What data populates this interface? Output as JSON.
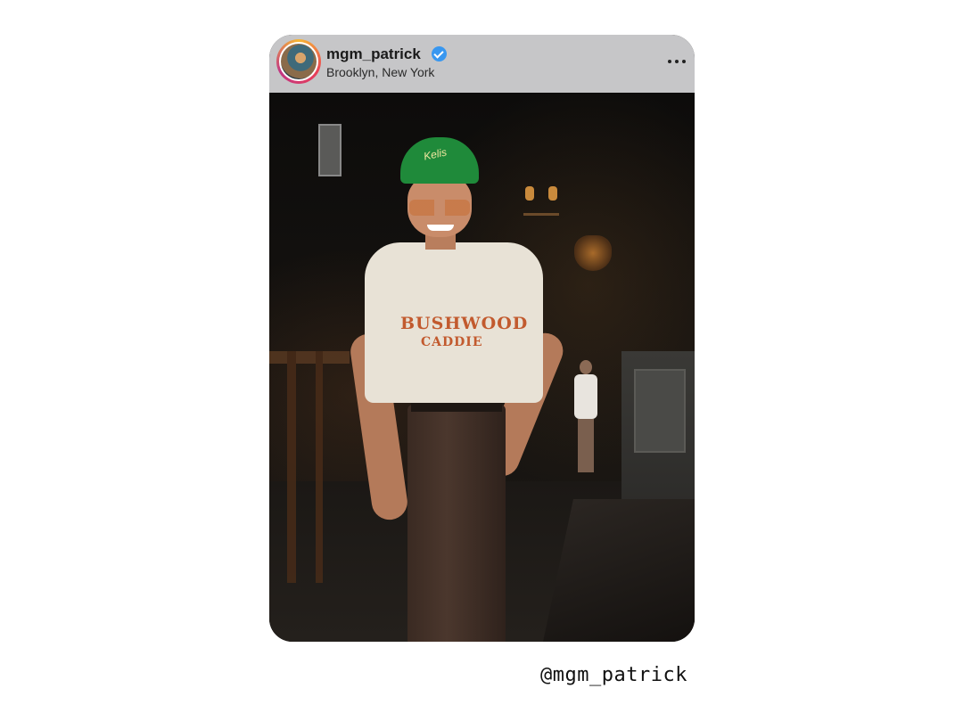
{
  "post": {
    "username": "mgm_patrick",
    "location": "Brooklyn, New York",
    "verified": true,
    "icons": {
      "avatar": "avatar-image",
      "verified": "verified-badge-icon",
      "more": "more-options-icon"
    },
    "photo": {
      "cap_text": "Kelis",
      "shirt_line1": "BUSHWOOD",
      "shirt_line2": "CADDIE"
    }
  },
  "credit": "@mgm_patrick",
  "colors": {
    "header_bg": "#c6c6c8",
    "verified_blue": "#3897f0",
    "cap_green": "#1f8a3a",
    "shirt_text": "#c25a2e"
  }
}
